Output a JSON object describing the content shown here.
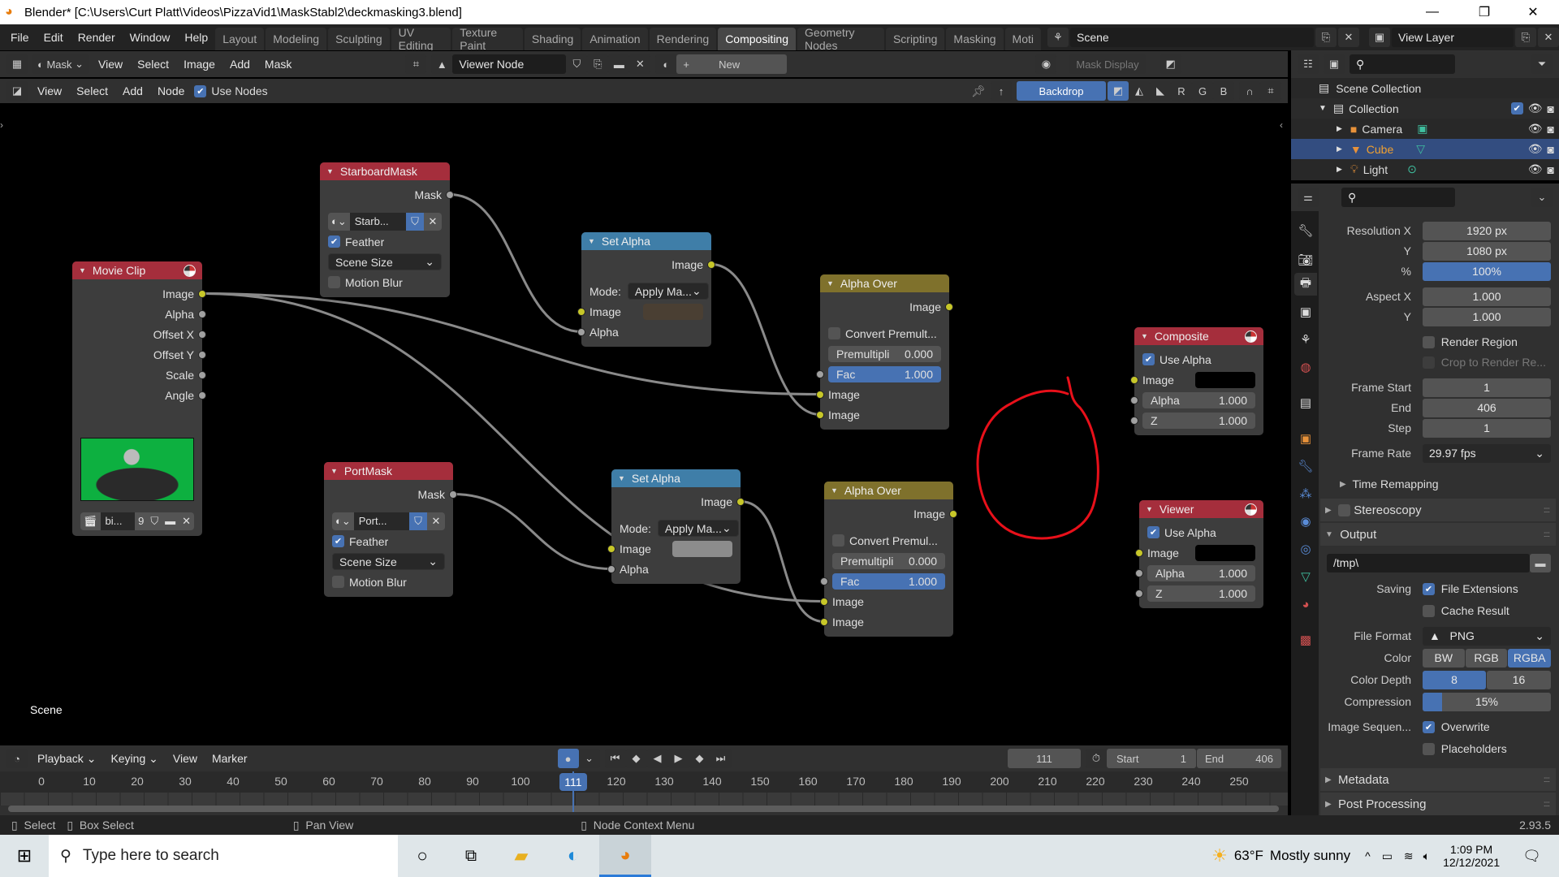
{
  "title_bar": {
    "title": "Blender* [C:\\Users\\Curt Platt\\Videos\\PizzaVid1\\MaskStabl2\\deckmasking3.blend]",
    "minimize": "—",
    "maximize": "❐",
    "close": "✕"
  },
  "menu": [
    "File",
    "Edit",
    "Render",
    "Window",
    "Help"
  ],
  "workspaces": [
    "Layout",
    "Modeling",
    "Sculpting",
    "UV Editing",
    "Texture Paint",
    "Shading",
    "Animation",
    "Rendering",
    "Compositing",
    "Geometry Nodes",
    "Scripting",
    "Masking",
    "Moti"
  ],
  "active_workspace": "Compositing",
  "scene": "Scene",
  "view_layer": "View Layer",
  "image_header": {
    "mode": "Mask",
    "menus": [
      "View",
      "Select",
      "Image",
      "Add",
      "Mask"
    ],
    "image": "Viewer Node",
    "new": "New",
    "mask_display": "Mask Display"
  },
  "node_header": {
    "menus": [
      "View",
      "Select",
      "Add",
      "Node"
    ],
    "use_nodes": "Use Nodes",
    "use_nodes_checked": true,
    "backdrop": "Backdrop",
    "channels": [
      "R",
      "G",
      "B"
    ]
  },
  "canvas": {
    "scene_label": "Scene",
    "annotation_color": "#e8101a"
  },
  "colors": {
    "input_header": "#a52e3c",
    "output_header": "#a52e3c",
    "converter_header": "#3f7ea8",
    "color_header": "#7f712c",
    "socket_image": "#c7c729",
    "socket_value": "#a1a1a1",
    "accent": "#4772b3"
  },
  "nodes": [
    {
      "id": "movieclip",
      "title": "Movie Clip",
      "kind": "input",
      "render_icon": true,
      "rows": [
        {
          "type": "out",
          "label": "Image",
          "socket": "yellow"
        },
        {
          "type": "out",
          "label": "Alpha",
          "socket": "gray"
        },
        {
          "type": "out",
          "label": "Offset X",
          "socket": "gray"
        },
        {
          "type": "out",
          "label": "Offset Y",
          "socket": "gray"
        },
        {
          "type": "out",
          "label": "Scale",
          "socket": "gray"
        },
        {
          "type": "out",
          "label": "Angle",
          "socket": "gray"
        },
        {
          "type": "preview"
        },
        {
          "type": "clip",
          "name": "bi...",
          "users": "9"
        }
      ]
    },
    {
      "id": "starboard",
      "title": "StarboardMask",
      "kind": "input",
      "rows": [
        {
          "type": "out",
          "label": "Mask",
          "socket": "gray"
        },
        {
          "type": "spacer"
        },
        {
          "type": "datablock",
          "name": "Starb..."
        },
        {
          "type": "check",
          "label": "Feather",
          "checked": true
        },
        {
          "type": "select",
          "label": "Scene Size"
        },
        {
          "type": "check",
          "label": "Motion Blur",
          "checked": false
        }
      ]
    },
    {
      "id": "portmask",
      "title": "PortMask",
      "kind": "input",
      "rows": [
        {
          "type": "out",
          "label": "Mask",
          "socket": "gray"
        },
        {
          "type": "spacer"
        },
        {
          "type": "datablock",
          "name": "Port..."
        },
        {
          "type": "check",
          "label": "Feather",
          "checked": true
        },
        {
          "type": "select",
          "label": "Scene Size"
        },
        {
          "type": "check",
          "label": "Motion Blur",
          "checked": false
        }
      ]
    },
    {
      "id": "setalpha1",
      "title": "Set Alpha",
      "kind": "converter",
      "rows": [
        {
          "type": "out",
          "label": "Image",
          "socket": "yellow"
        },
        {
          "type": "spacer"
        },
        {
          "type": "mode",
          "label": "Mode:",
          "value": "Apply Ma..."
        },
        {
          "type": "in",
          "label": "Image",
          "socket": "yellow",
          "swatch": "#4a3f33"
        },
        {
          "type": "in",
          "label": "Alpha",
          "socket": "gray"
        }
      ]
    },
    {
      "id": "setalpha2",
      "title": "Set Alpha",
      "kind": "converter",
      "rows": [
        {
          "type": "out",
          "label": "Image",
          "socket": "yellow"
        },
        {
          "type": "spacer"
        },
        {
          "type": "mode",
          "label": "Mode:",
          "value": "Apply Ma..."
        },
        {
          "type": "in",
          "label": "Image",
          "socket": "yellow",
          "swatch": "#8c8c8c"
        },
        {
          "type": "in",
          "label": "Alpha",
          "socket": "gray"
        }
      ]
    },
    {
      "id": "alphaover1",
      "title": "Alpha Over",
      "kind": "color",
      "rows": [
        {
          "type": "out",
          "label": "Image",
          "socket": "yellow"
        },
        {
          "type": "spacer"
        },
        {
          "type": "check",
          "label": "Convert Premult...",
          "checked": false
        },
        {
          "type": "value",
          "label": "Premultipli",
          "value": "0.000"
        },
        {
          "type": "value",
          "label": "Fac",
          "value": "1.000",
          "blue": true,
          "socket": "gray"
        },
        {
          "type": "in",
          "label": "Image",
          "socket": "yellow"
        },
        {
          "type": "in",
          "label": "Image",
          "socket": "yellow"
        }
      ]
    },
    {
      "id": "alphaover2",
      "title": "Alpha Over",
      "kind": "color",
      "rows": [
        {
          "type": "out",
          "label": "Image",
          "socket": "yellow"
        },
        {
          "type": "spacer"
        },
        {
          "type": "check",
          "label": "Convert Premul...",
          "checked": false
        },
        {
          "type": "value",
          "label": "Premultipli",
          "value": "0.000"
        },
        {
          "type": "value",
          "label": "Fac",
          "value": "1.000",
          "blue": true,
          "socket": "gray"
        },
        {
          "type": "in",
          "label": "Image",
          "socket": "yellow"
        },
        {
          "type": "in",
          "label": "Image",
          "socket": "yellow"
        }
      ]
    },
    {
      "id": "composite",
      "title": "Composite",
      "kind": "output",
      "render_icon": true,
      "rows": [
        {
          "type": "check",
          "label": "Use Alpha",
          "checked": true
        },
        {
          "type": "in",
          "label": "Image",
          "socket": "yellow",
          "swatch": "#000000"
        },
        {
          "type": "value",
          "label": "Alpha",
          "value": "1.000",
          "socket": "gray"
        },
        {
          "type": "value",
          "label": "Z",
          "value": "1.000",
          "socket": "gray"
        }
      ]
    },
    {
      "id": "viewer",
      "title": "Viewer",
      "kind": "output",
      "render_icon": true,
      "rows": [
        {
          "type": "check",
          "label": "Use Alpha",
          "checked": true
        },
        {
          "type": "in",
          "label": "Image",
          "socket": "yellow",
          "swatch": "#000000"
        },
        {
          "type": "value",
          "label": "Alpha",
          "value": "1.000",
          "socket": "gray"
        },
        {
          "type": "value",
          "label": "Z",
          "value": "1.000",
          "socket": "gray"
        }
      ]
    }
  ],
  "links": [
    {
      "from": "movieclip",
      "out": 0,
      "to": "alphaover1",
      "in": 5
    },
    {
      "from": "movieclip",
      "out": 0,
      "to": "alphaover2",
      "in": 5
    },
    {
      "from": "starboard",
      "out": 0,
      "to": "setalpha1",
      "in": 4
    },
    {
      "from": "setalpha1",
      "out": 0,
      "to": "alphaover1",
      "in": 6
    },
    {
      "from": "portmask",
      "out": 0,
      "to": "setalpha2",
      "in": 4
    },
    {
      "from": "setalpha2",
      "out": 0,
      "to": "alphaover2",
      "in": 6
    }
  ],
  "outliner": {
    "items": [
      {
        "label": "Scene Collection",
        "icon": "scene-collection-icon"
      },
      {
        "label": "Collection",
        "icon": "collection-icon",
        "checked": true
      },
      {
        "label": "Camera",
        "icon": "camera-icon"
      },
      {
        "label": "Cube",
        "icon": "mesh-icon",
        "selected": true
      },
      {
        "label": "Light",
        "icon": "light-icon"
      }
    ]
  },
  "properties": {
    "resolution_x_label": "Resolution X",
    "resolution_x": "1920 px",
    "y_label": "Y",
    "resolution_y": "1080 px",
    "percent_label": "%",
    "percent": "100%",
    "aspect_x_label": "Aspect X",
    "aspect_x": "1.000",
    "aspect_y": "1.000",
    "render_region": "Render Region",
    "crop": "Crop to Render Re...",
    "frame_start_label": "Frame Start",
    "frame_start": "1",
    "end_label": "End",
    "frame_end": "406",
    "step_label": "Step",
    "step": "1",
    "frame_rate_label": "Frame Rate",
    "frame_rate": "29.97 fps",
    "time_remapping": "Time Remapping",
    "stereoscopy": "Stereoscopy",
    "output": "Output",
    "path": "/tmp\\",
    "saving_label": "Saving",
    "file_extensions": "File Extensions",
    "cache_result": "Cache Result",
    "file_format_label": "File Format",
    "file_format": "PNG",
    "color_label": "Color",
    "color_options": [
      "BW",
      "RGB",
      "RGBA"
    ],
    "color_selected": "RGBA",
    "color_depth_label": "Color Depth",
    "depth_options": [
      "8",
      "16"
    ],
    "depth_selected": "8",
    "compression_label": "Compression",
    "compression": "15%",
    "compression_value": 15,
    "image_sequence_label": "Image Sequen...",
    "overwrite": "Overwrite",
    "placeholders": "Placeholders",
    "metadata": "Metadata",
    "post_processing": "Post Processing"
  },
  "timeline": {
    "menus": [
      "Playback",
      "Keying",
      "View",
      "Marker"
    ],
    "current_frame": "111",
    "start_label": "Start",
    "start": "1",
    "end_label": "End",
    "end": "406",
    "ticks": [
      0,
      10,
      20,
      30,
      40,
      50,
      60,
      70,
      80,
      90,
      100,
      110,
      120,
      130,
      140,
      150,
      160,
      170,
      180,
      190,
      200,
      210,
      220,
      230,
      240,
      250
    ]
  },
  "status": {
    "select": "Select",
    "box_select": "Box Select",
    "pan_view": "Pan View",
    "context_menu": "Node Context Menu",
    "version": "2.93.5"
  },
  "taskbar": {
    "search_placeholder": "Type here to search",
    "temp": "63°F",
    "weather": "Mostly sunny",
    "time": "1:09 PM",
    "date": "12/12/2021"
  }
}
